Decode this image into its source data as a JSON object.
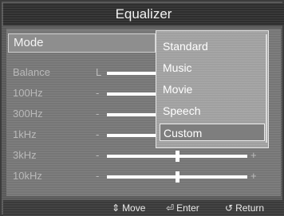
{
  "title": "Equalizer",
  "mode": {
    "label": "Mode"
  },
  "settings": [
    {
      "label": "Balance",
      "left": "L",
      "level": 0.5
    },
    {
      "label": "100Hz",
      "left": "-",
      "level": 0.5
    },
    {
      "label": "300Hz",
      "left": "-",
      "level": 0.5
    },
    {
      "label": "1kHz",
      "left": "-",
      "level": 0.5
    },
    {
      "label": "3kHz",
      "left": "-",
      "right": "+",
      "level": 0.5
    },
    {
      "label": "10kHz",
      "left": "-",
      "right": "+",
      "level": 0.5
    }
  ],
  "dropdown": {
    "options": [
      "Standard",
      "Music",
      "Movie",
      "Speech",
      "Custom"
    ],
    "selected": "Custom"
  },
  "footer": {
    "move": {
      "icon": "up-down-arrows-icon",
      "label": "Move"
    },
    "enter": {
      "icon": "enter-icon",
      "label": "Enter"
    },
    "return": {
      "icon": "return-icon",
      "label": "Return"
    }
  }
}
